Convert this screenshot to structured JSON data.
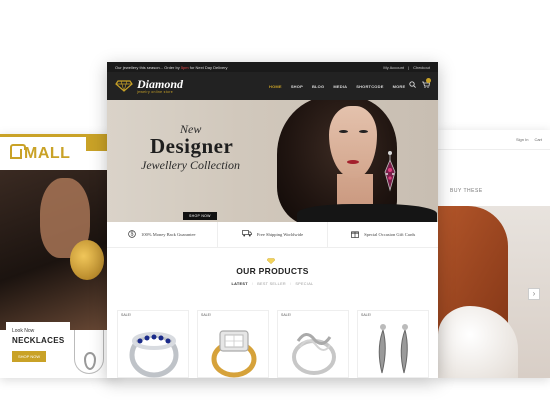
{
  "left_screen": {
    "logo": "MALL",
    "card_eyebrow": "Look Now",
    "card_title": "NECKLACES",
    "card_button": "SHOP NOW"
  },
  "right_screen": {
    "top_links": [
      "Sign In",
      "Cart"
    ],
    "buy_label": "BUY THESE"
  },
  "main_screen": {
    "promo_text_before": "Our jewellery this season... Order by",
    "promo_highlight": "5pm",
    "promo_text_after": "for Next Day Delivery",
    "account_links": [
      "My Account",
      "Checkout"
    ],
    "brand_name": "Diamond",
    "brand_tagline": "jewelry online store",
    "nav": [
      "HOME",
      "SHOP",
      "BLOG",
      "MEDIA",
      "SHORTCODE",
      "MORE"
    ],
    "nav_active": "HOME",
    "hero": {
      "eyebrow": "New",
      "title": "Designer",
      "subtitle": "Jewellery Collection",
      "button": "SHOP NOW"
    },
    "features": [
      {
        "icon": "dollar-icon",
        "glyph": "$",
        "text": "100% Money Back Guarantee"
      },
      {
        "icon": "truck-icon",
        "glyph": "🚚",
        "text": "Free Shipping Worldwide"
      },
      {
        "icon": "gift-icon",
        "glyph": "🎁",
        "text": "Special Occasion Gift Cards"
      }
    ],
    "products_title": "OUR PRODUCTS",
    "product_tabs": [
      "LATEST",
      "BEST SELLER",
      "SPECIAL"
    ],
    "product_tab_active": "LATEST",
    "product_badges": [
      "SALE!",
      "SALE!",
      "SALE!",
      "SALE!"
    ],
    "colors": {
      "accent": "#c9a227",
      "header_bg": "#222222",
      "promo_sale": "#e54848"
    }
  }
}
